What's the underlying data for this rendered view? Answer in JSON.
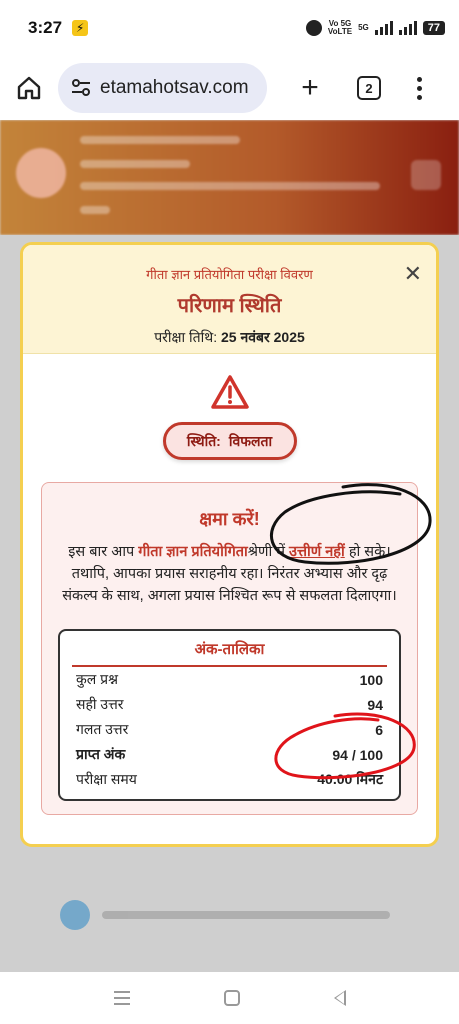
{
  "status_bar": {
    "time": "3:27",
    "network_label_top": "Vo 5G",
    "network_label_bottom": "VoLTE",
    "network_5g": "5G",
    "battery": "77"
  },
  "browser": {
    "url": "etamahotsav.com",
    "tab_count": "2"
  },
  "modal": {
    "subtitle": "गीता ज्ञान प्रतियोगिता परीक्षा विवरण",
    "title": "परिणाम स्थिति",
    "date_label": "परीक्षा तिथि:",
    "date_value": "25 नवंबर 2025",
    "status_label": "स्थिति:",
    "status_value": "विफलता",
    "result_heading": "क्षमा करें!",
    "msg_part1": "इस बार आप",
    "msg_highlight1": "गीता ज्ञान प्रतियोगिता",
    "msg_part2": "श्रेणी में",
    "msg_highlight2": "उत्तीर्ण नहीं",
    "msg_part3": "हो सके। तथापि, आपका प्रयास सराहनीय रहा। निरंतर अभ्यास और दृढ़ संकल्प के साथ, अगला प्रयास निश्चित रूप से सफलता दिलाएगा।",
    "scorecard": {
      "title": "अंक-तालिका",
      "rows": [
        {
          "label": "कुल प्रश्न",
          "value": "100"
        },
        {
          "label": "सही उत्तर",
          "value": "94"
        },
        {
          "label": "गलत उत्तर",
          "value": "6"
        },
        {
          "label": "प्राप्त अंक",
          "value": "94 / 100"
        },
        {
          "label": "परीक्षा समय",
          "value": "40.00 मिनट"
        }
      ]
    }
  },
  "colors": {
    "accent_red": "#c0392b",
    "modal_border": "#f4cf50",
    "header_bg": "#fdf4d4"
  }
}
